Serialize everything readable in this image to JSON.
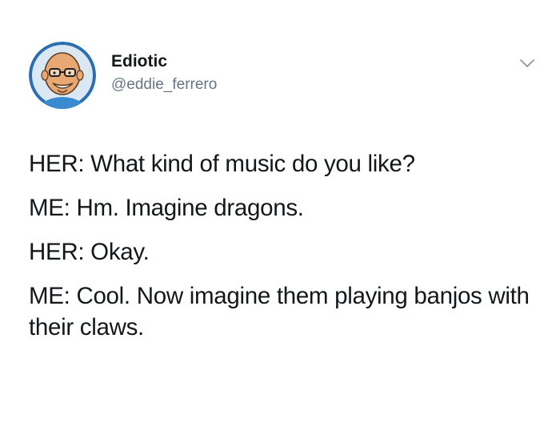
{
  "tweet": {
    "author": {
      "display_name": "Ediotic",
      "handle": "@eddie_ferrero"
    },
    "icons": {
      "avatar": "avatar-cartoon-man-with-glasses",
      "menu": "chevron-down-icon"
    },
    "lines": [
      "HER: What kind of music do you like?",
      "ME: Hm. Imagine dragons.",
      "HER: Okay.",
      "ME: Cool. Now imagine them playing banjos with their claws."
    ]
  }
}
